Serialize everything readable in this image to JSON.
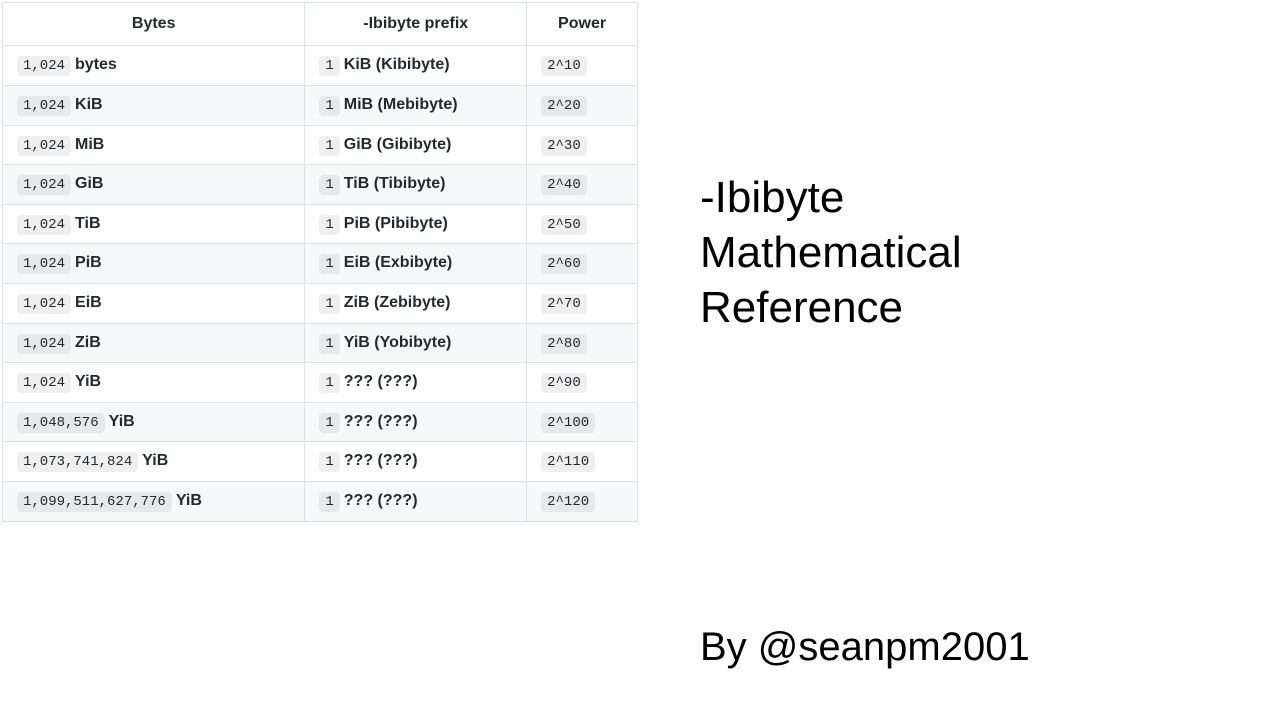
{
  "table": {
    "headers": {
      "bytes": "Bytes",
      "prefix": "-Ibibyte prefix",
      "power": "Power"
    },
    "rows": [
      {
        "bytes_num": "1,024",
        "bytes_unit": "bytes",
        "prefix_num": "1",
        "prefix_label": "KiB (Kibibyte)",
        "power": "2^10"
      },
      {
        "bytes_num": "1,024",
        "bytes_unit": "KiB",
        "prefix_num": "1",
        "prefix_label": "MiB (Mebibyte)",
        "power": "2^20"
      },
      {
        "bytes_num": "1,024",
        "bytes_unit": "MiB",
        "prefix_num": "1",
        "prefix_label": "GiB (Gibibyte)",
        "power": "2^30"
      },
      {
        "bytes_num": "1,024",
        "bytes_unit": "GiB",
        "prefix_num": "1",
        "prefix_label": "TiB (Tibibyte)",
        "power": "2^40"
      },
      {
        "bytes_num": "1,024",
        "bytes_unit": "TiB",
        "prefix_num": "1",
        "prefix_label": "PiB (Pibibyte)",
        "power": "2^50"
      },
      {
        "bytes_num": "1,024",
        "bytes_unit": "PiB",
        "prefix_num": "1",
        "prefix_label": "EiB (Exbibyte)",
        "power": "2^60"
      },
      {
        "bytes_num": "1,024",
        "bytes_unit": "EiB",
        "prefix_num": "1",
        "prefix_label": "ZiB (Zebibyte)",
        "power": "2^70"
      },
      {
        "bytes_num": "1,024",
        "bytes_unit": "ZiB",
        "prefix_num": "1",
        "prefix_label": "YiB (Yobibyte)",
        "power": "2^80"
      },
      {
        "bytes_num": "1,024",
        "bytes_unit": "YiB",
        "prefix_num": "1",
        "prefix_label": "??? (???)",
        "power": "2^90"
      },
      {
        "bytes_num": "1,048,576",
        "bytes_unit": "YiB",
        "prefix_num": "1",
        "prefix_label": "??? (???)",
        "power": "2^100"
      },
      {
        "bytes_num": "1,073,741,824",
        "bytes_unit": "YiB",
        "prefix_num": "1",
        "prefix_label": "??? (???)",
        "power": "2^110"
      },
      {
        "bytes_num": "1,099,511,627,776",
        "bytes_unit": "YiB",
        "prefix_num": "1",
        "prefix_label": "??? (???)",
        "power": "2^120"
      }
    ]
  },
  "title": "-Ibibyte\nMathematical\nReference",
  "byline": "By @seanpm2001"
}
